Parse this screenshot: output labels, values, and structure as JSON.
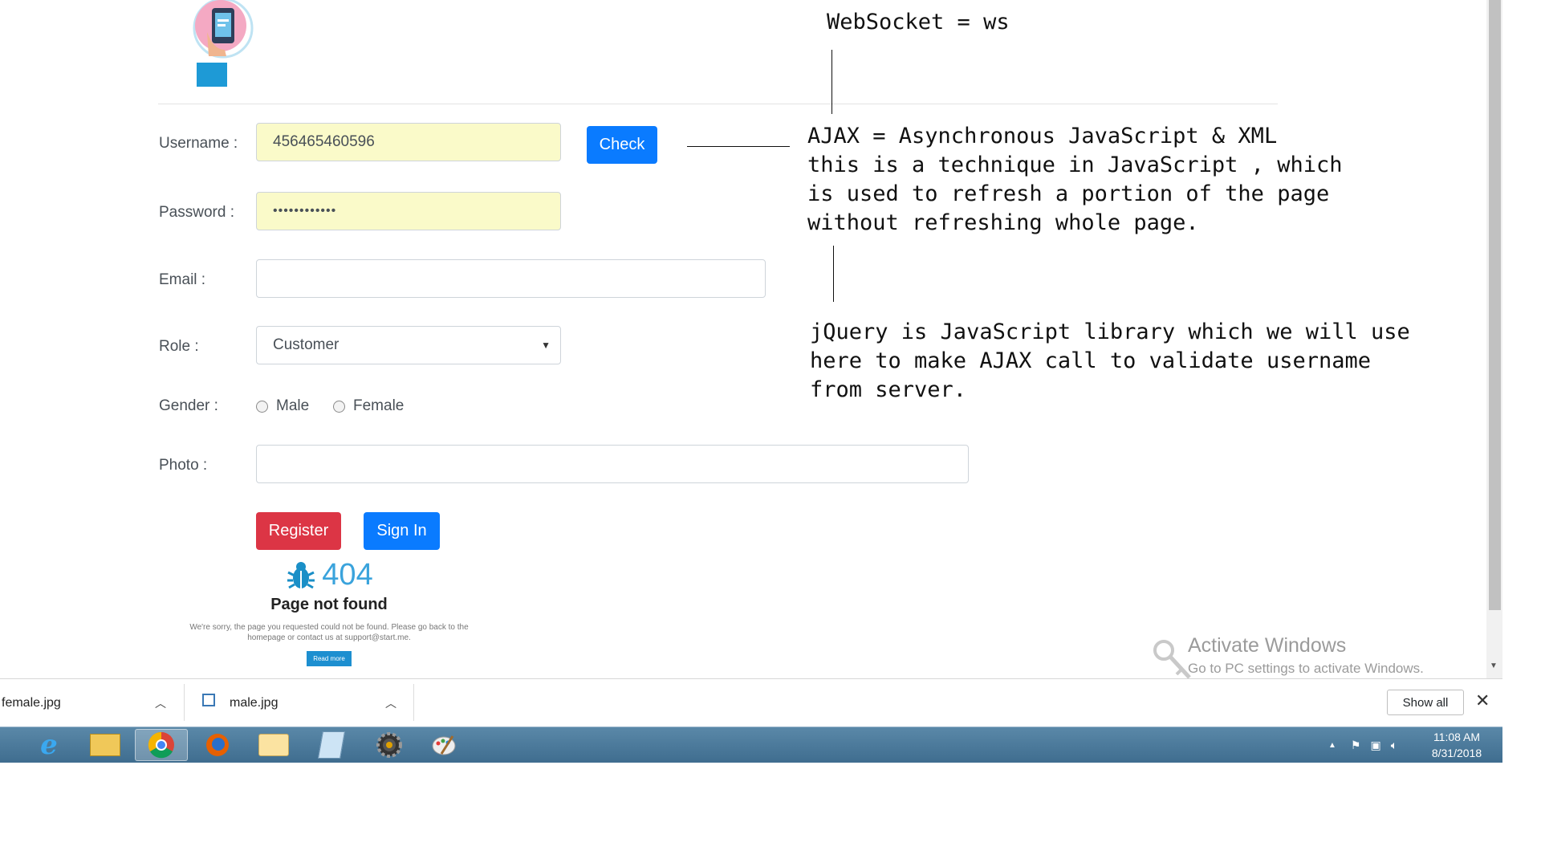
{
  "form": {
    "username_label": "Username :",
    "username_value": "456465460596",
    "check_button": "Check",
    "password_label": "Password :",
    "password_value": "••••••••••••",
    "email_label": "Email :",
    "email_value": "",
    "role_label": "Role :",
    "role_value": "Customer",
    "gender_label": "Gender :",
    "gender_male": "Male",
    "gender_female": "Female",
    "photo_label": "Photo :",
    "register_button": "Register",
    "signin_button": "Sign In"
  },
  "notes": {
    "websocket": "WebSocket = ws",
    "ajax_line1": "AJAX = Asynchronous JavaScript & XML",
    "ajax_line2": "this is a technique in JavaScript , which",
    "ajax_line3": "is used to refresh a portion of the page",
    "ajax_line4": "without refreshing whole page.",
    "jquery_line1": "jQuery is JavaScript library which we will use",
    "jquery_line2": "here to make AJAX call to validate username",
    "jquery_line3": "from server."
  },
  "not_found": {
    "code": "404",
    "title": "Page not found",
    "text": "We're sorry, the page you requested could not be found. Please go back to the homepage or contact us at support@start.me.",
    "button": "Read more"
  },
  "watermark": {
    "title": "Activate Windows",
    "subtitle": "Go to PC settings to activate Windows."
  },
  "downloads": {
    "item1": "female.jpg",
    "item2": "male.jpg",
    "show_all": "Show all"
  },
  "taskbar": {
    "time": "11:08 AM",
    "date": "8/31/2018"
  },
  "colors": {
    "primary": "#0a7bff",
    "danger": "#dc3545",
    "autofill": "#fafac9"
  }
}
